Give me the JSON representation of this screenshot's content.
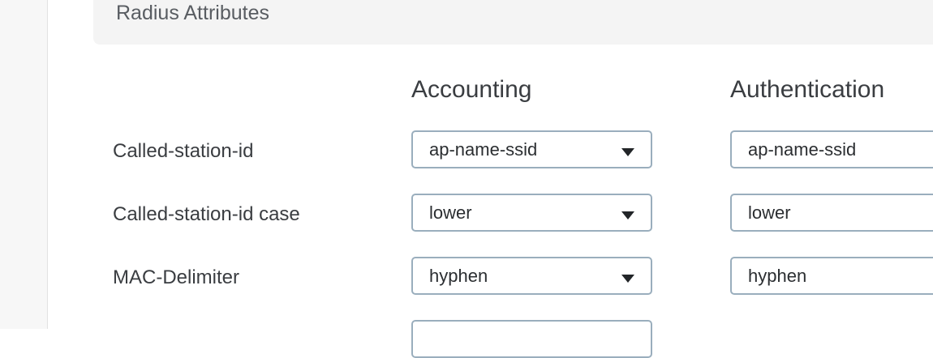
{
  "section": {
    "title": "Radius Attributes"
  },
  "columns": {
    "accounting": "Accounting",
    "authentication": "Authentication"
  },
  "rows": [
    {
      "label": "Called-station-id",
      "accounting": "ap-name-ssid",
      "authentication": "ap-name-ssid"
    },
    {
      "label": "Called-station-id case",
      "accounting": "lower",
      "authentication": "lower"
    },
    {
      "label": "MAC-Delimiter",
      "accounting": "hyphen",
      "authentication": "hyphen"
    }
  ],
  "icons": {
    "dropdown": "caret-down-icon"
  }
}
